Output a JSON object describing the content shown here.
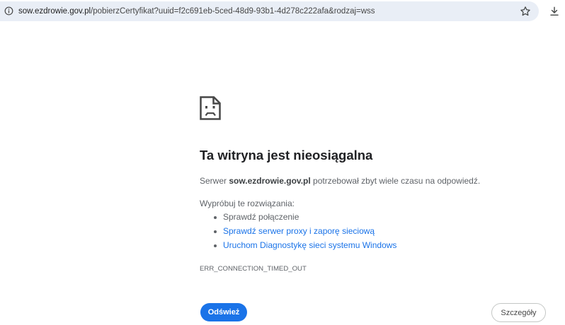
{
  "browser": {
    "url_domain": "sow.ezdrowie.gov.pl",
    "url_rest": "/pobierzCertyfikat?uuid=f2c691eb-5ced-48d9-93b1-4d278c222afa&rodzaj=wss",
    "icons": {
      "site_info": "info-icon",
      "bookmark": "star-icon",
      "downloads": "download-icon"
    }
  },
  "error": {
    "icon": "sad-page-icon",
    "title": "Ta witryna jest nieosiągalna",
    "message_prefix": "Serwer ",
    "message_host": "sow.ezdrowie.gov.pl",
    "message_suffix": " potrzebował zbyt wiele czasu na odpowiedź.",
    "suggestions_heading": "Wypróbuj te rozwiązania:",
    "suggestions": [
      "Sprawdź połączenie",
      "Sprawdź serwer proxy i zaporę sieciową",
      "Uruchom Diagnostykę sieci systemu Windows"
    ],
    "code": "ERR_CONNECTION_TIMED_OUT"
  },
  "buttons": {
    "reload": "Odśwież",
    "details": "Szczegóły"
  },
  "colors": {
    "accent": "#1a73e8",
    "title": "#202124",
    "text": "#5f6368",
    "omnibox": "#e9eef6"
  }
}
